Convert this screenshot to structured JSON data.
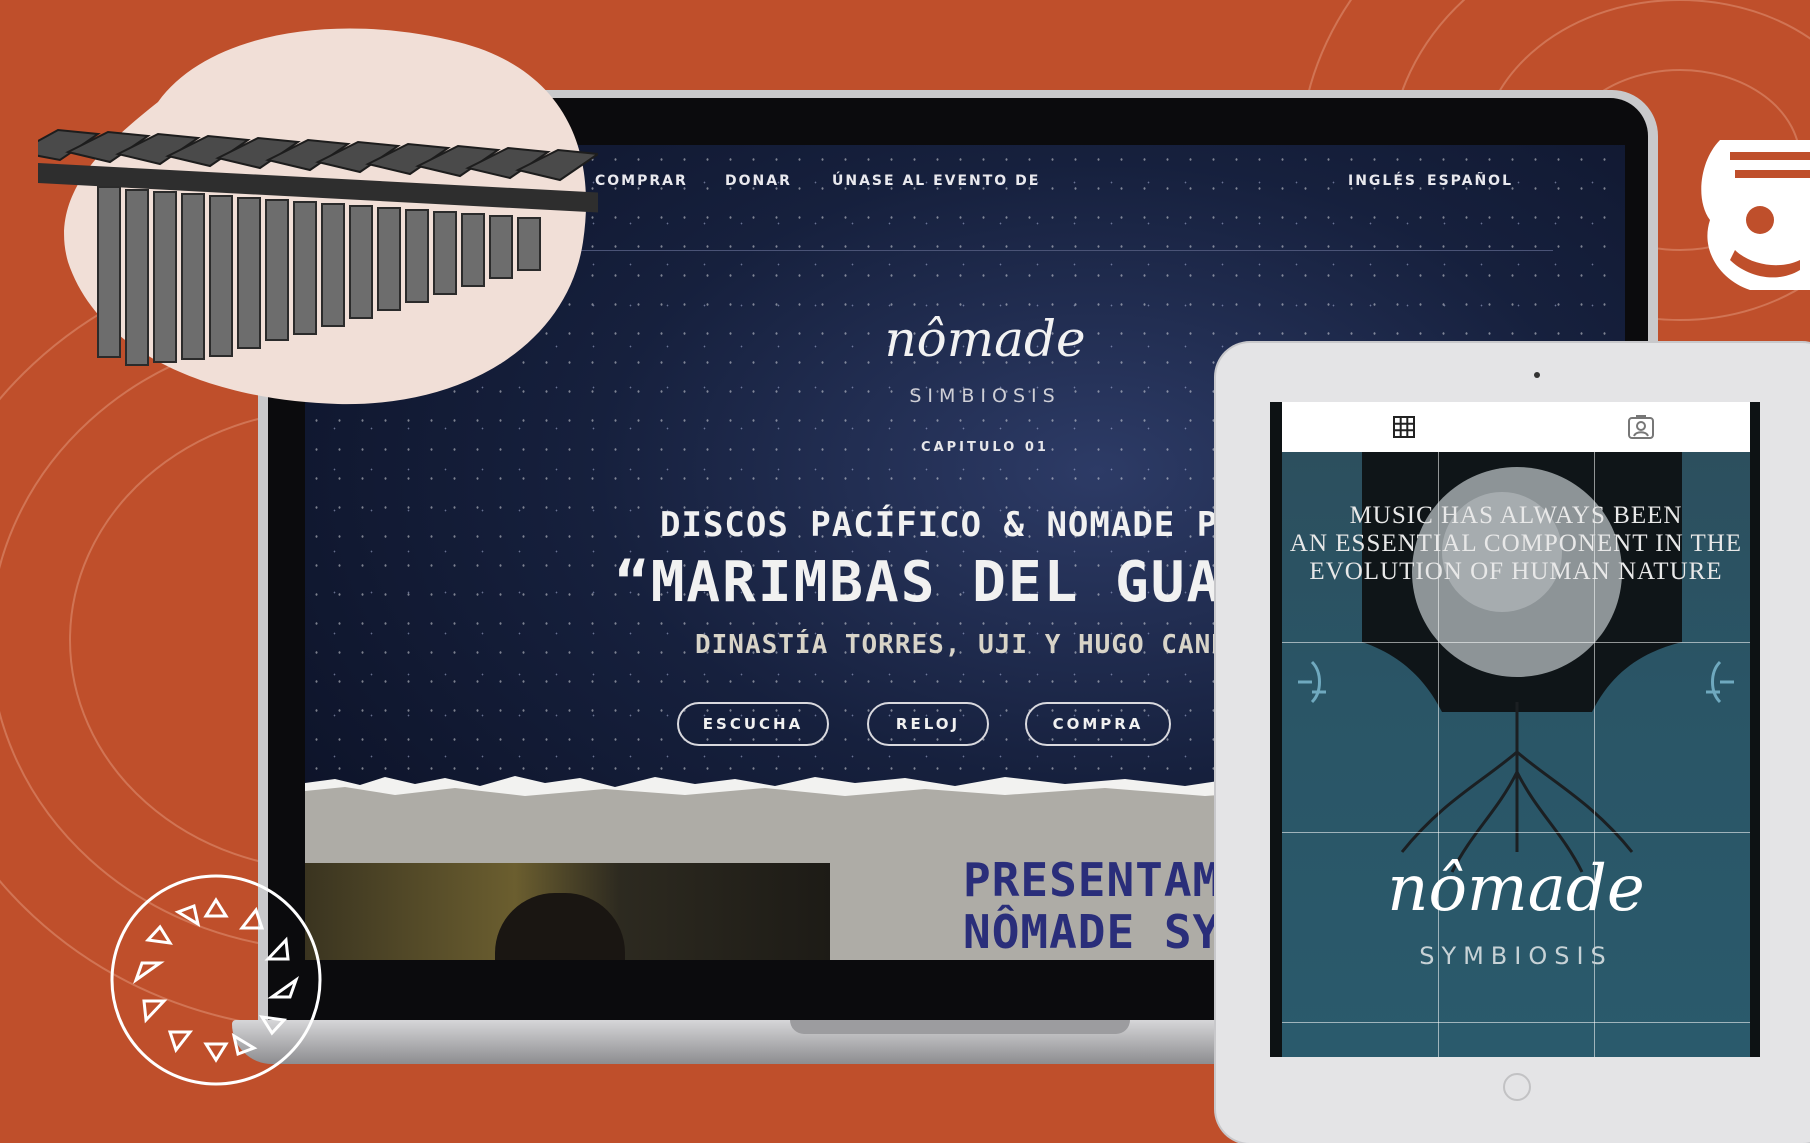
{
  "laptop": {
    "nav": {
      "items": [
        "COMPRAR",
        "DONAR",
        "ÚNASE AL EVENTO DE"
      ],
      "languages": [
        "INGLÉS",
        "ESPAÑOL"
      ]
    },
    "logo": "nômade",
    "logo_sub": "SIMBIOSIS",
    "chapter": "CAPITULO 01",
    "headline_1": "DISCOS PACÍFICO & NOMADE PRESENTE:",
    "headline_2": "“MARIMBAS DEL GUAPI EI",
    "headline_3": "DINASTÍA TORRES, UJI Y HUGO CANDELARIO",
    "buttons": [
      "ESCUCHA",
      "RELOJ",
      "COMPRA"
    ],
    "present_1": "PRESENTAMO",
    "present_2": "NÔMADE SYMI"
  },
  "tablet": {
    "tabs": [
      "grid-icon",
      "profile-icon"
    ],
    "quote_1": "MUSIC HAS ALWAYS BEEN",
    "quote_2": "AN ESSENTIAL COMPONENT IN THE",
    "quote_3": "EVOLUTION OF HUMAN NATURE",
    "logo": "nômade",
    "logo_sub": "SYMBIOSIS"
  },
  "colors": {
    "background": "#bf4f2b",
    "night_sky": "#16203d",
    "tablet_teal": "#2a5566",
    "presentamos_blue": "#2a2e7a"
  }
}
